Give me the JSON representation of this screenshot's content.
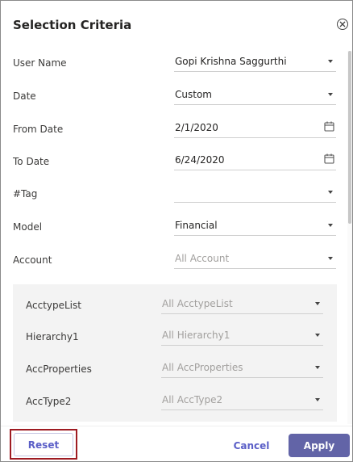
{
  "dialog": {
    "title": "Selection Criteria"
  },
  "fields": [
    {
      "label": "User Name",
      "value": "Gopi Krishna Saggurthi",
      "control": "dropdown"
    },
    {
      "label": "Date",
      "value": "Custom",
      "control": "dropdown"
    },
    {
      "label": "From Date",
      "value": "2/1/2020",
      "control": "date"
    },
    {
      "label": "To Date",
      "value": "6/24/2020",
      "control": "date"
    },
    {
      "label": "#Tag",
      "value": "",
      "control": "dropdown"
    },
    {
      "label": "Model",
      "value": "Financial",
      "control": "dropdown"
    },
    {
      "label": "Account",
      "placeholder": "All Account",
      "control": "dropdown"
    }
  ],
  "account_filters": [
    {
      "label": "AcctypeList",
      "placeholder": "All AcctypeList"
    },
    {
      "label": "Hierarchy1",
      "placeholder": "All Hierarchy1"
    },
    {
      "label": "AccProperties",
      "placeholder": "All AccProperties"
    },
    {
      "label": "AccType2",
      "placeholder": "All AccType2"
    }
  ],
  "footer": {
    "reset_label": "Reset",
    "cancel_label": "Cancel",
    "apply_label": "Apply"
  },
  "colors": {
    "accent": "#6264a7",
    "link": "#5b5fc7",
    "highlight_outline": "#9e1b22",
    "panel_bg": "#f3f3f3"
  }
}
